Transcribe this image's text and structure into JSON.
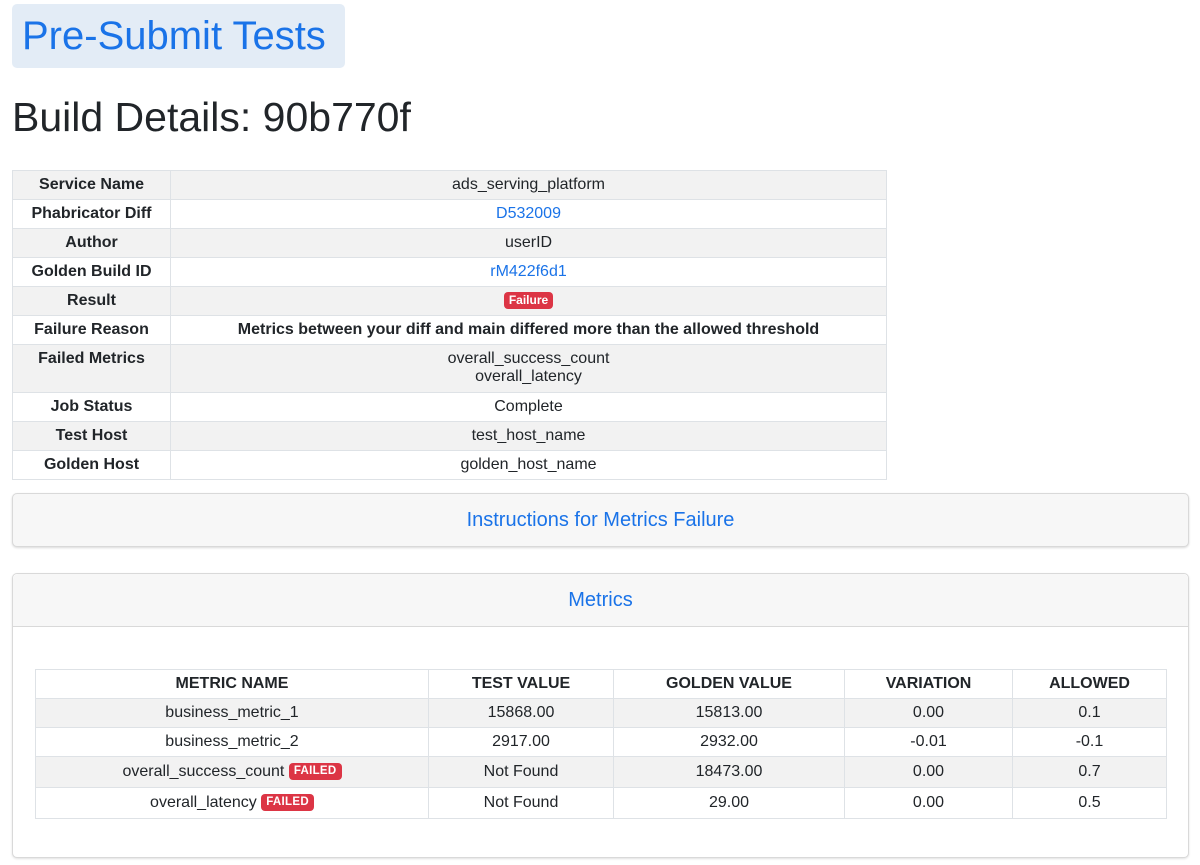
{
  "nav": {
    "label": "Pre-Submit Tests"
  },
  "page": {
    "title": "Build Details: 90b770f"
  },
  "details": {
    "rows": [
      {
        "key": "Service Name",
        "value": "ads_serving_platform"
      },
      {
        "key": "Phabricator Diff",
        "value": "D532009"
      },
      {
        "key": "Author",
        "value": "userID"
      },
      {
        "key": "Golden Build ID",
        "value": "rM422f6d1"
      },
      {
        "key": "Result",
        "value": "Failure"
      },
      {
        "key": "Failure Reason",
        "value": "Metrics between your diff and main differed more than the allowed threshold"
      },
      {
        "key": "Failed Metrics",
        "values": [
          "overall_success_count",
          "overall_latency"
        ]
      },
      {
        "key": "Job Status",
        "value": "Complete"
      },
      {
        "key": "Test Host",
        "value": "test_host_name"
      },
      {
        "key": "Golden Host",
        "value": "golden_host_name"
      }
    ]
  },
  "instructions": {
    "label": "Instructions for Metrics Failure"
  },
  "metrics": {
    "label": "Metrics",
    "columns": [
      "METRIC NAME",
      "TEST VALUE",
      "GOLDEN VALUE",
      "VARIATION",
      "ALLOWED"
    ],
    "rows": [
      {
        "name": "business_metric_1",
        "test": "15868.00",
        "golden": "15813.00",
        "variation": "0.00",
        "allowed": "0.1"
      },
      {
        "name": "business_metric_2",
        "test": "2917.00",
        "golden": "2932.00",
        "variation": "-0.01",
        "allowed": "-0.1"
      },
      {
        "name": "overall_success_count",
        "badge": "FAILED",
        "test": "Not Found",
        "golden": "18473.00",
        "variation": "0.00",
        "allowed": "0.7"
      },
      {
        "name": "overall_latency",
        "badge": "FAILED",
        "test": "Not Found",
        "golden": "29.00",
        "variation": "0.00",
        "allowed": "0.5"
      }
    ]
  },
  "colors": {
    "link": "#1a73e8",
    "danger": "#dc3545",
    "nav_bg": "#e3ecf6",
    "stripe": "#f2f2f2"
  }
}
